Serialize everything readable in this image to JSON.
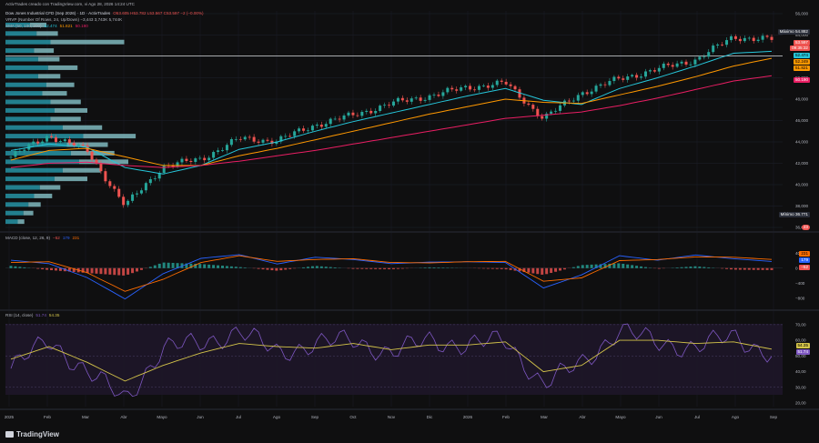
{
  "top_note": "ActivTrades creado con TradingView.com, vi Ago 28, 2026 14:24 UTC",
  "legend": {
    "symbol": "Dow Jones Industrial CFD (Sep 2026) · 1D · ActivTrades",
    "ohlc": "O53.605  H53.782  L53.567  C53.597  −2 (−0.00%)",
    "vrvp": "VRVP (Number Of Rows, 24, Up/Down)  −3,443  3,743K  5,744K",
    "sma": "SMA (50, 100, 200)",
    "sma_values": [
      "52.474",
      "51.821",
      "50.190"
    ],
    "macd": "MACD (close, 12, 26, 9)",
    "macd_values": [
      "−52",
      "179",
      "231"
    ],
    "rsi": "RSI (14, close)",
    "rsi_values": [
      "51.74",
      "54.35"
    ]
  },
  "price_tags": {
    "maximo": "Máximo",
    "maximo_val": "54.882",
    "last": "53.597",
    "countdown": "09:35:32",
    "sma50": "52.474",
    "sma100": "52.249",
    "sma200": "51.821",
    "sma_alt": "50.190",
    "minimo": "Mínimo",
    "minimo_val": "36.771",
    "flag": "23"
  },
  "macd_tags": [
    "231",
    "179",
    "−52"
  ],
  "rsi_tags": [
    "54.35",
    "51.74"
  ],
  "price_axis": [
    "56,000",
    "54,000",
    "52,000",
    "50,000",
    "48,000",
    "46,000",
    "44,000",
    "42,000",
    "40,000",
    "38,000",
    "36,000"
  ],
  "macd_axis": [
    "400",
    "0",
    "−400",
    "−800"
  ],
  "rsi_axis": [
    "70,00",
    "60,00",
    "50,00",
    "40,00",
    "30,00",
    "20,00"
  ],
  "time_axis": [
    "2025",
    "Feb",
    "Mar",
    "Abr",
    "Mayo",
    "Jun",
    "Jul",
    "Ago",
    "Sep",
    "Oct",
    "Nov",
    "Dic",
    "2026",
    "Feb",
    "Mar",
    "Abr",
    "Mayo",
    "Jun",
    "Jul",
    "Ago",
    "Sep"
  ],
  "brand": "TradingView",
  "colors": {
    "up": "#26a69a",
    "down": "#ef5350",
    "sma50": "#26c6da",
    "sma100": "#ff9800",
    "sma200": "#e91e63",
    "macd": "#2962ff",
    "signal": "#ff6d00",
    "rsi": "#7e57c2",
    "rsi_ma": "#d4c44a",
    "vp_up": "#2aa6b8",
    "vp_down": "#8fd0d6"
  },
  "chart_data": {
    "type": "line",
    "title": "Dow Jones Industrial CFD (Sep 2026) · 1D · ActivTrades",
    "months": [
      "2025",
      "Feb",
      "Mar",
      "Abr",
      "Mayo",
      "Jun",
      "Jul",
      "Ago",
      "Sep",
      "Oct",
      "Nov",
      "Dic",
      "2026",
      "Feb",
      "Mar",
      "Abr",
      "Mayo",
      "Jun",
      "Jul",
      "Ago",
      "Sep"
    ],
    "price_ylim": [
      36000,
      56000
    ],
    "series": [
      {
        "name": "Close",
        "values": [
          42600,
          44600,
          43200,
          38000,
          41700,
          42400,
          44300,
          44100,
          45600,
          46500,
          47600,
          48300,
          49100,
          49500,
          46200,
          48600,
          49900,
          50800,
          51700,
          53800,
          53597
        ]
      },
      {
        "name": "SMA 50",
        "values": [
          43200,
          43800,
          43500,
          41600,
          41000,
          41800,
          43300,
          44000,
          45000,
          45900,
          46700,
          47500,
          48300,
          49000,
          47900,
          47500,
          49000,
          50000,
          51100,
          52300,
          52474
        ]
      },
      {
        "name": "SMA 100",
        "values": [
          42300,
          43200,
          43400,
          42600,
          41800,
          41800,
          42700,
          43400,
          44200,
          45000,
          45800,
          46600,
          47300,
          48000,
          47700,
          47600,
          48400,
          49200,
          50100,
          51100,
          51821
        ]
      },
      {
        "name": "SMA 200",
        "values": [
          41600,
          42000,
          42100,
          41800,
          41600,
          41800,
          42200,
          42700,
          43200,
          43800,
          44400,
          45000,
          45600,
          46200,
          46500,
          46800,
          47400,
          48100,
          48900,
          49700,
          50190
        ]
      }
    ],
    "indicators": {
      "macd": {
        "values": [
          210,
          120,
          -250,
          -820,
          -150,
          260,
          360,
          110,
          290,
          230,
          120,
          160,
          170,
          150,
          -530,
          -180,
          330,
          210,
          350,
          250,
          179
        ]
      },
      "signal": {
        "values": [
          150,
          170,
          -120,
          -620,
          -300,
          150,
          330,
          180,
          230,
          250,
          150,
          140,
          170,
          180,
          -350,
          -260,
          200,
          230,
          300,
          290,
          231
        ]
      },
      "rsi": {
        "values": [
          42,
          60,
          40,
          22,
          55,
          58,
          66,
          52,
          58,
          60,
          52,
          60,
          57,
          60,
          32,
          45,
          67,
          58,
          56,
          62,
          51.74
        ]
      },
      "rsi_ma": {
        "values": [
          48,
          56,
          46,
          34,
          44,
          52,
          58,
          56,
          55,
          58,
          54,
          57,
          57,
          59,
          40,
          44,
          60,
          60,
          58,
          59,
          54.35
        ]
      }
    },
    "volume_profile": {
      "price_rows": [
        36500,
        37300,
        38100,
        38900,
        39700,
        40500,
        41300,
        42100,
        42900,
        43700,
        44500,
        45300,
        46100,
        46900,
        47700,
        48500,
        49300,
        50100,
        50900,
        51700,
        52500,
        53300,
        54100,
        54900
      ],
      "up": [
        1.5,
        2.2,
        2.8,
        3.5,
        4.2,
        6.0,
        7.0,
        9.0,
        8.0,
        7.5,
        9.5,
        7.0,
        5.5,
        6.0,
        5.5,
        4.5,
        5.0,
        4.0,
        5.2,
        4.0,
        3.5,
        5.5,
        3.8,
        3.0
      ],
      "down": [
        0.8,
        1.2,
        1.5,
        2.2,
        2.5,
        4.0,
        4.6,
        6.0,
        5.3,
        5.0,
        6.4,
        4.8,
        3.7,
        4.0,
        3.7,
        3.0,
        3.4,
        2.7,
        3.6,
        2.6,
        2.4,
        9.0,
        2.6,
        2.0
      ]
    }
  }
}
